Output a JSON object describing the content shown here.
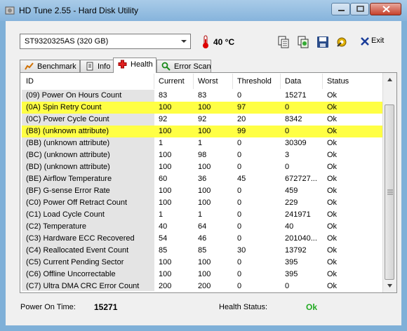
{
  "window": {
    "title": "HD Tune 2.55 - Hard Disk Utility"
  },
  "toolbar": {
    "drive": "ST9320325AS (320 GB)",
    "temperature": "40 °C",
    "exit_label": "Exit",
    "icons": [
      "copy-icon",
      "copy-info-icon",
      "save-icon",
      "options-icon"
    ]
  },
  "tabs": [
    {
      "label": "Benchmark",
      "icon": "benchmark-icon"
    },
    {
      "label": "Info",
      "icon": "info-icon"
    },
    {
      "label": "Health",
      "icon": "health-icon",
      "active": true
    },
    {
      "label": "Error Scan",
      "icon": "error-scan-icon"
    }
  ],
  "table": {
    "columns": [
      "ID",
      "Current",
      "Worst",
      "Threshold",
      "Data",
      "Status"
    ],
    "rows": [
      {
        "id": "(09) Power On Hours Count",
        "current": "83",
        "worst": "83",
        "threshold": "0",
        "data": "15271",
        "status": "Ok",
        "highlight": false
      },
      {
        "id": "(0A) Spin Retry Count",
        "current": "100",
        "worst": "100",
        "threshold": "97",
        "data": "0",
        "status": "Ok",
        "highlight": true
      },
      {
        "id": "(0C) Power Cycle Count",
        "current": "92",
        "worst": "92",
        "threshold": "20",
        "data": "8342",
        "status": "Ok",
        "highlight": false
      },
      {
        "id": "(B8) (unknown attribute)",
        "current": "100",
        "worst": "100",
        "threshold": "99",
        "data": "0",
        "status": "Ok",
        "highlight": true
      },
      {
        "id": "(BB) (unknown attribute)",
        "current": "1",
        "worst": "1",
        "threshold": "0",
        "data": "30309",
        "status": "Ok",
        "highlight": false
      },
      {
        "id": "(BC) (unknown attribute)",
        "current": "100",
        "worst": "98",
        "threshold": "0",
        "data": "3",
        "status": "Ok",
        "highlight": false
      },
      {
        "id": "(BD) (unknown attribute)",
        "current": "100",
        "worst": "100",
        "threshold": "0",
        "data": "0",
        "status": "Ok",
        "highlight": false
      },
      {
        "id": "(BE) Airflow Temperature",
        "current": "60",
        "worst": "36",
        "threshold": "45",
        "data": "672727...",
        "status": "Ok",
        "highlight": false
      },
      {
        "id": "(BF) G-sense Error Rate",
        "current": "100",
        "worst": "100",
        "threshold": "0",
        "data": "459",
        "status": "Ok",
        "highlight": false
      },
      {
        "id": "(C0) Power Off Retract Count",
        "current": "100",
        "worst": "100",
        "threshold": "0",
        "data": "229",
        "status": "Ok",
        "highlight": false
      },
      {
        "id": "(C1) Load Cycle Count",
        "current": "1",
        "worst": "1",
        "threshold": "0",
        "data": "241971",
        "status": "Ok",
        "highlight": false
      },
      {
        "id": "(C2) Temperature",
        "current": "40",
        "worst": "64",
        "threshold": "0",
        "data": "40",
        "status": "Ok",
        "highlight": false
      },
      {
        "id": "(C3) Hardware ECC Recovered",
        "current": "54",
        "worst": "46",
        "threshold": "0",
        "data": "201040...",
        "status": "Ok",
        "highlight": false
      },
      {
        "id": "(C4) Reallocated Event Count",
        "current": "85",
        "worst": "85",
        "threshold": "30",
        "data": "13792",
        "status": "Ok",
        "highlight": false
      },
      {
        "id": "(C5) Current Pending Sector",
        "current": "100",
        "worst": "100",
        "threshold": "0",
        "data": "395",
        "status": "Ok",
        "highlight": false
      },
      {
        "id": "(C6) Offline Uncorrectable",
        "current": "100",
        "worst": "100",
        "threshold": "0",
        "data": "395",
        "status": "Ok",
        "highlight": false
      },
      {
        "id": "(C7) Ultra DMA CRC Error Count",
        "current": "200",
        "worst": "200",
        "threshold": "0",
        "data": "0",
        "status": "Ok",
        "highlight": false
      }
    ]
  },
  "footer": {
    "power_on_label": "Power On Time:",
    "power_on_value": "15271",
    "health_label": "Health Status:",
    "health_value": "Ok"
  },
  "colors": {
    "highlight": "#ffff44",
    "health_ok": "#22aa22",
    "titlebar": "#86b4dc"
  }
}
